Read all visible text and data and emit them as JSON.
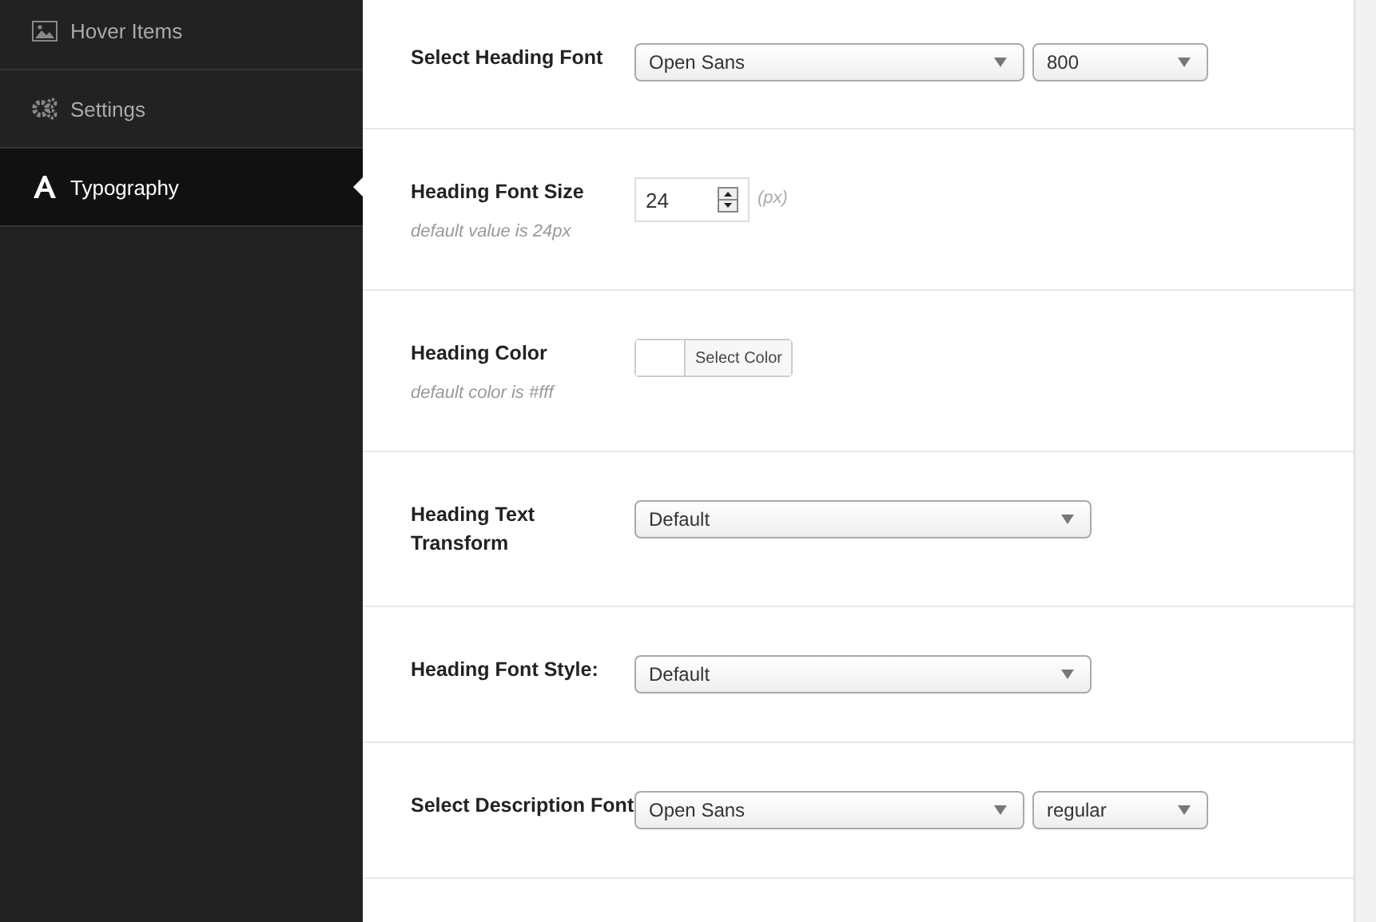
{
  "sidebar": {
    "items": [
      {
        "label": "Hover Items",
        "kind": "image",
        "selected": false
      },
      {
        "label": "Settings",
        "kind": "gears",
        "selected": false
      },
      {
        "label": "Typography",
        "kind": "letter",
        "selected": true
      }
    ]
  },
  "settings": [
    {
      "kind": "select",
      "label": "Select Heading Font",
      "value": "Open Sans",
      "second_value": "800"
    },
    {
      "kind": "number",
      "label": "Heading Font Size",
      "value": "24",
      "unit": "(px)",
      "description": "default value is 24px"
    },
    {
      "kind": "color",
      "label": "Heading Color",
      "button": "Select Color",
      "description": "default color is #fff"
    },
    {
      "kind": "select",
      "label": "Heading Text Transform",
      "value": "Default"
    },
    {
      "kind": "select",
      "label": "Heading Font Style:",
      "value": "Default"
    },
    {
      "kind": "select",
      "label": "Select Description Font",
      "value": "Open Sans",
      "second_value": "regular"
    }
  ]
}
